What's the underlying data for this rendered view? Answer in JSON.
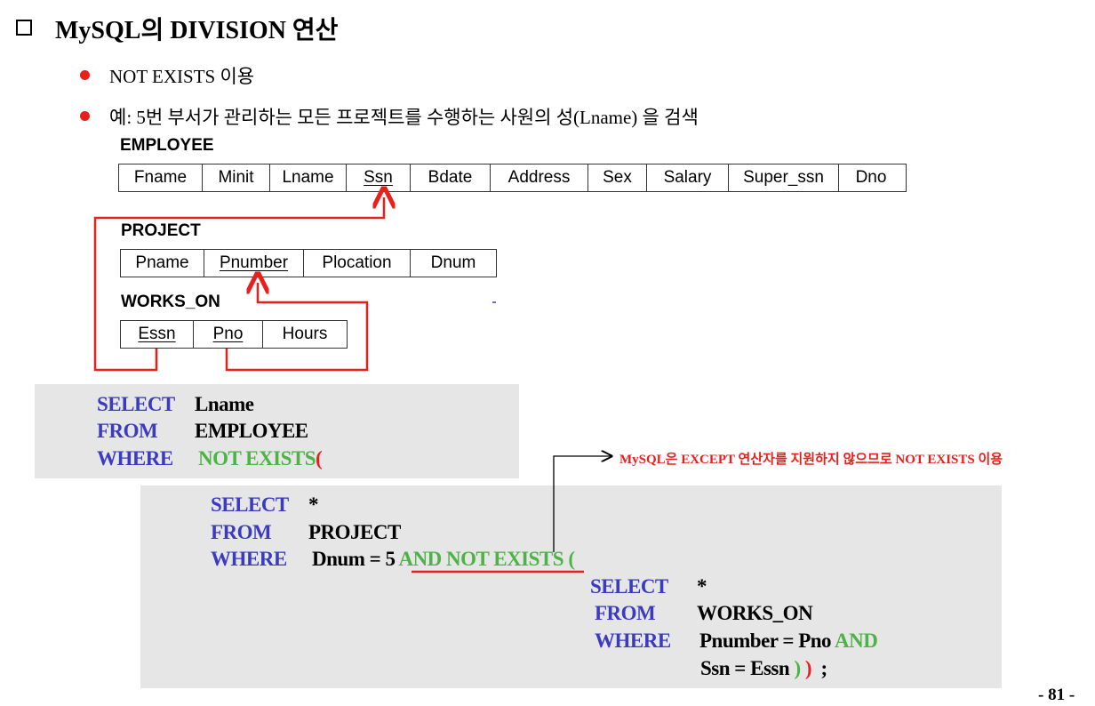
{
  "title": "MySQL의 DIVISION 연산",
  "bullets": [
    "NOT EXISTS 이용",
    "예: 5번 부서가 관리하는 모든 프로젝트를 수행하는 사원의 성(Lname) 을 검색"
  ],
  "tables": {
    "employee": {
      "name": "EMPLOYEE",
      "columns": [
        "Fname",
        "Minit",
        "Lname",
        "Ssn",
        "Bdate",
        "Address",
        "Sex",
        "Salary",
        "Super_ssn",
        "Dno"
      ]
    },
    "project": {
      "name": "PROJECT",
      "columns": [
        "Pname",
        "Pnumber",
        "Plocation",
        "Dnum"
      ]
    },
    "works_on": {
      "name": "WORKS_ON",
      "columns": [
        "Essn",
        "Pno",
        "Hours"
      ]
    }
  },
  "query": {
    "outer": {
      "select_kw": "SELECT",
      "select_val": "Lname",
      "from_kw": "FROM",
      "from_val": "EMPLOYEE",
      "where_kw": "WHERE",
      "where_val": "NOT EXISTS",
      "paren": "("
    },
    "middle": {
      "select_kw": "SELECT",
      "select_val": "*",
      "from_kw": "FROM",
      "from_val": "PROJECT",
      "where_kw": "WHERE",
      "where_val": "Dnum = 5",
      "and_kw": "AND",
      "not_exists": "NOT EXISTS",
      "paren": "("
    },
    "inner": {
      "select_kw": "SELECT",
      "select_val": "*",
      "from_kw": "FROM",
      "from_val": "WORKS_ON",
      "where_kw": "WHERE",
      "where_val": "Pnumber = Pno",
      "and_kw": "AND",
      "cond2": "Ssn = Essn",
      "close_inner": ")",
      "close_outer": ")",
      "semicolon": ";"
    }
  },
  "note": "MySQL은 EXCEPT 연산자를 지원하지 않으므로 NOT EXISTS 이용",
  "page_number": "- 81 -",
  "colors": {
    "keyword": "#3a3ac2",
    "green": "#4db347",
    "red": "#e8201b",
    "panel": "#e6e6e6"
  }
}
